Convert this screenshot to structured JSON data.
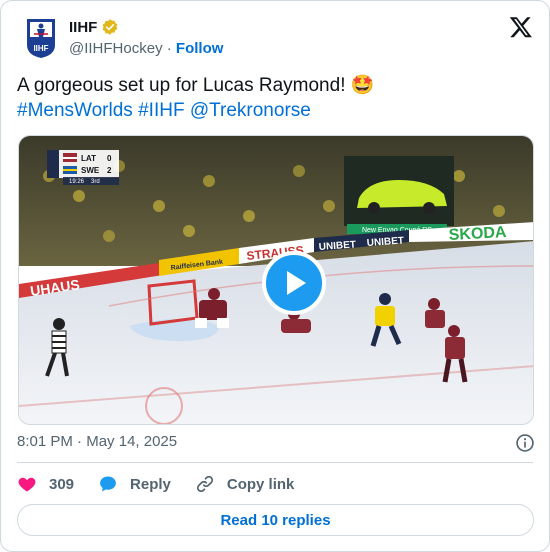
{
  "author": {
    "name": "IIHF",
    "handle": "@IIHFHockey",
    "separator": "·",
    "follow_label": "Follow",
    "verified_color": "#e2b719",
    "logo_text": "IIHF"
  },
  "tweet": {
    "text": "A gorgeous set up for Lucas Raymond! 🤩",
    "hashtags": [
      "#MensWorlds",
      "#IIHF"
    ],
    "mention": "@Trekronorse"
  },
  "video": {
    "scoreboard": {
      "team1": "LAT",
      "score1": "0",
      "team2": "SWE",
      "score2": "2",
      "clock": "19:26",
      "period": "3rd"
    },
    "rink_board_texts": [
      "UNIBET",
      "UNIBET",
      "SKODA",
      "UHAUS",
      "STRAUSS",
      "Raiffeisen Bank",
      "New Enyaq Coupé RS"
    ],
    "play_icon": "play-icon"
  },
  "meta": {
    "time": "8:01 PM",
    "date_sep": "·",
    "date": "May 14, 2025"
  },
  "actions": {
    "likes": "309",
    "reply_label": "Reply",
    "copy_link_label": "Copy link"
  },
  "read_replies_label": "Read 10 replies",
  "colors": {
    "accent": "#006fd6",
    "like": "#f91880",
    "reply": "#1d9bf0",
    "secondary_text": "#536471"
  }
}
